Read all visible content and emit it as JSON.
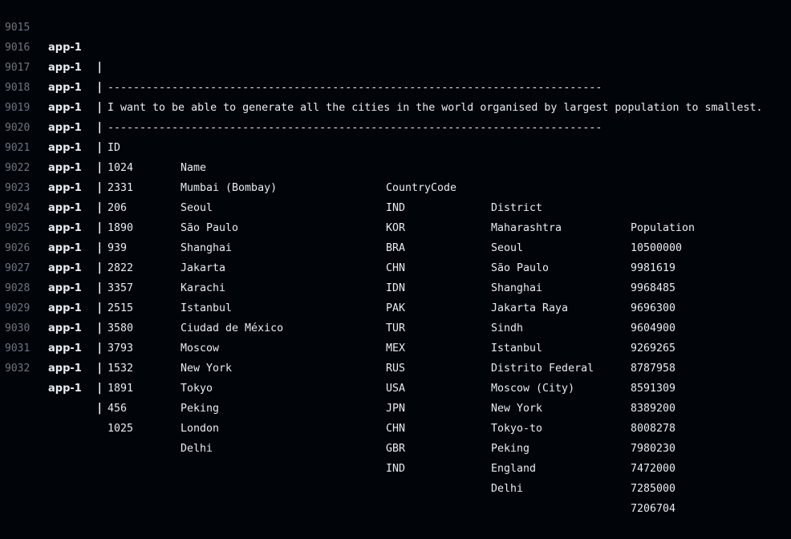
{
  "terminal": {
    "service": "app-1",
    "separator": "|",
    "intro_lines": [
      {
        "line": "9015",
        "text": "-----------------------------------------------------------------------------"
      },
      {
        "line": "9016",
        "text": "I want to be able to generate all the cities in the world organised by largest population to smallest."
      },
      {
        "line": "9017",
        "text": "-----------------------------------------------------------------------------"
      }
    ],
    "header": {
      "line": "9018",
      "id": "ID",
      "name": "Name",
      "code": "CountryCode",
      "district": "District",
      "population": "Population"
    },
    "rows": [
      {
        "line": "9019",
        "id": "1024",
        "name": "Mumbai (Bombay)",
        "code": "IND",
        "district": "Maharashtra",
        "population": "10500000"
      },
      {
        "line": "9020",
        "id": "2331",
        "name": "Seoul",
        "code": "KOR",
        "district": "Seoul",
        "population": "9981619"
      },
      {
        "line": "9021",
        "id": "206",
        "name": "São Paulo",
        "code": "BRA",
        "district": "São Paulo",
        "population": "9968485"
      },
      {
        "line": "9022",
        "id": "1890",
        "name": "Shanghai",
        "code": "CHN",
        "district": "Shanghai",
        "population": "9696300"
      },
      {
        "line": "9023",
        "id": "939",
        "name": "Jakarta",
        "code": "IDN",
        "district": "Jakarta Raya",
        "population": "9604900"
      },
      {
        "line": "9024",
        "id": "2822",
        "name": "Karachi",
        "code": "PAK",
        "district": "Sindh",
        "population": "9269265"
      },
      {
        "line": "9025",
        "id": "3357",
        "name": "Istanbul",
        "code": "TUR",
        "district": "Istanbul",
        "population": "8787958"
      },
      {
        "line": "9026",
        "id": "2515",
        "name": "Ciudad de México",
        "code": "MEX",
        "district": "Distrito Federal",
        "population": "8591309"
      },
      {
        "line": "9027",
        "id": "3580",
        "name": "Moscow",
        "code": "RUS",
        "district": "Moscow (City)",
        "population": "8389200"
      },
      {
        "line": "9028",
        "id": "3793",
        "name": "New York",
        "code": "USA",
        "district": "New York",
        "population": "8008278"
      },
      {
        "line": "9029",
        "id": "1532",
        "name": "Tokyo",
        "code": "JPN",
        "district": "Tokyo-to",
        "population": "7980230"
      },
      {
        "line": "9030",
        "id": "1891",
        "name": "Peking",
        "code": "CHN",
        "district": "Peking",
        "population": "7472000"
      },
      {
        "line": "9031",
        "id": "456",
        "name": "London",
        "code": "GBR",
        "district": "England",
        "population": "7285000"
      },
      {
        "line": "9032",
        "id": "1025",
        "name": "Delhi",
        "code": "IND",
        "district": "Delhi",
        "population": "7206704"
      }
    ]
  }
}
